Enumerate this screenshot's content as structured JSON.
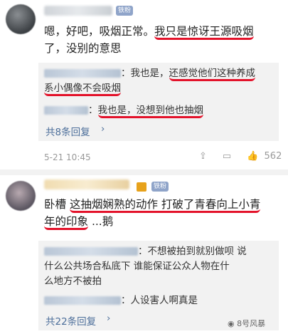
{
  "post1": {
    "badge": "铁粉",
    "text_a": "嗯，好吧，吸烟正常。",
    "text_b": "我只是惊讶王源吸烟",
    "text_c": "了，没别的意思",
    "replies": [
      {
        "sep": "：我也是，",
        "hl1": "还感觉他们这种养成",
        "hl2": "系小偶像不会吸烟",
        "rest": ""
      },
      {
        "sep": "：",
        "hl1": "我也是，没想到他也抽烟",
        "hl2": "",
        "rest": ""
      }
    ],
    "more": "共8条回复",
    "time": "5-21 10:45",
    "like_count": "562",
    "icons": [
      "share-icon",
      "comment-icon",
      "like-icon"
    ]
  },
  "post2": {
    "badge": "铁粉",
    "text_a": "卧槽 ",
    "text_b": "这抽烟娴熟的动作 打破了青春向上小青",
    "text_c": "年的印象",
    "text_d": " ...鹅",
    "replies": [
      {
        "line1": "：不想被拍到就别做呗 说",
        "line2": "什么公共场合私底下 谁能保证公众人物在什",
        "line3": "么地方不被拍"
      },
      {
        "line1": "：人设害人啊真是"
      }
    ],
    "more": "共22条回复"
  },
  "watermark": "8号风暴",
  "colors": {
    "highlight": "#e3122a",
    "link": "#4c6e9a",
    "badge": "#8fa4c9"
  }
}
